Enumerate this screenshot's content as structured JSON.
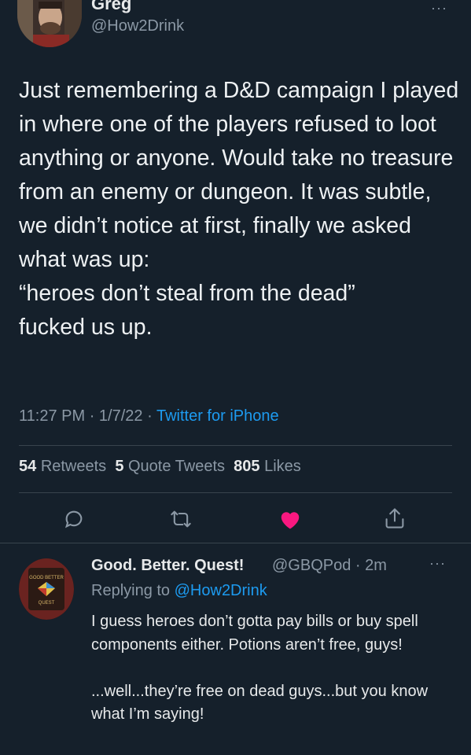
{
  "tweet": {
    "display_name": "Greg",
    "handle": "@How2Drink",
    "more": "···",
    "text": "Just remembering a D&D campaign I played in where one of the players refused to loot anything or anyone. Would take no treasure from an enemy or dungeon. It was subtle, we didn’t notice at first, finally we asked what was up:\n“heroes don’t steal from the dead”\nfucked us up.",
    "time": "11:27 PM",
    "date": "1/7/22",
    "source": "Twitter for iPhone",
    "sep": "·"
  },
  "stats": {
    "retweets_count": "54",
    "retweets_label": "Retweets",
    "quotes_count": "5",
    "quotes_label": "Quote Tweets",
    "likes_count": "805",
    "likes_label": "Likes"
  },
  "icons": {
    "reply": "reply-icon",
    "retweet": "retweet-icon",
    "like": "heart-icon",
    "share": "share-icon"
  },
  "colors": {
    "background": "#15202b",
    "accent": "#1d9bf0",
    "like": "#f91880",
    "secondary_text": "#8b98a5"
  },
  "reply": {
    "display_name": "Good. Better. Quest!",
    "handle_time": "@GBQPod · 2m",
    "more": "···",
    "replying_prefix": "Replying to",
    "replying_to": "@How2Drink",
    "text": "I guess heroes don’t gotta pay bills or buy spell components either. Potions aren’t free, guys!\n\n...well...they’re free on dead guys...but you know what I’m saying!",
    "avatar_text_top": "GOOD BETTER",
    "avatar_text_bottom": "QUEST"
  }
}
